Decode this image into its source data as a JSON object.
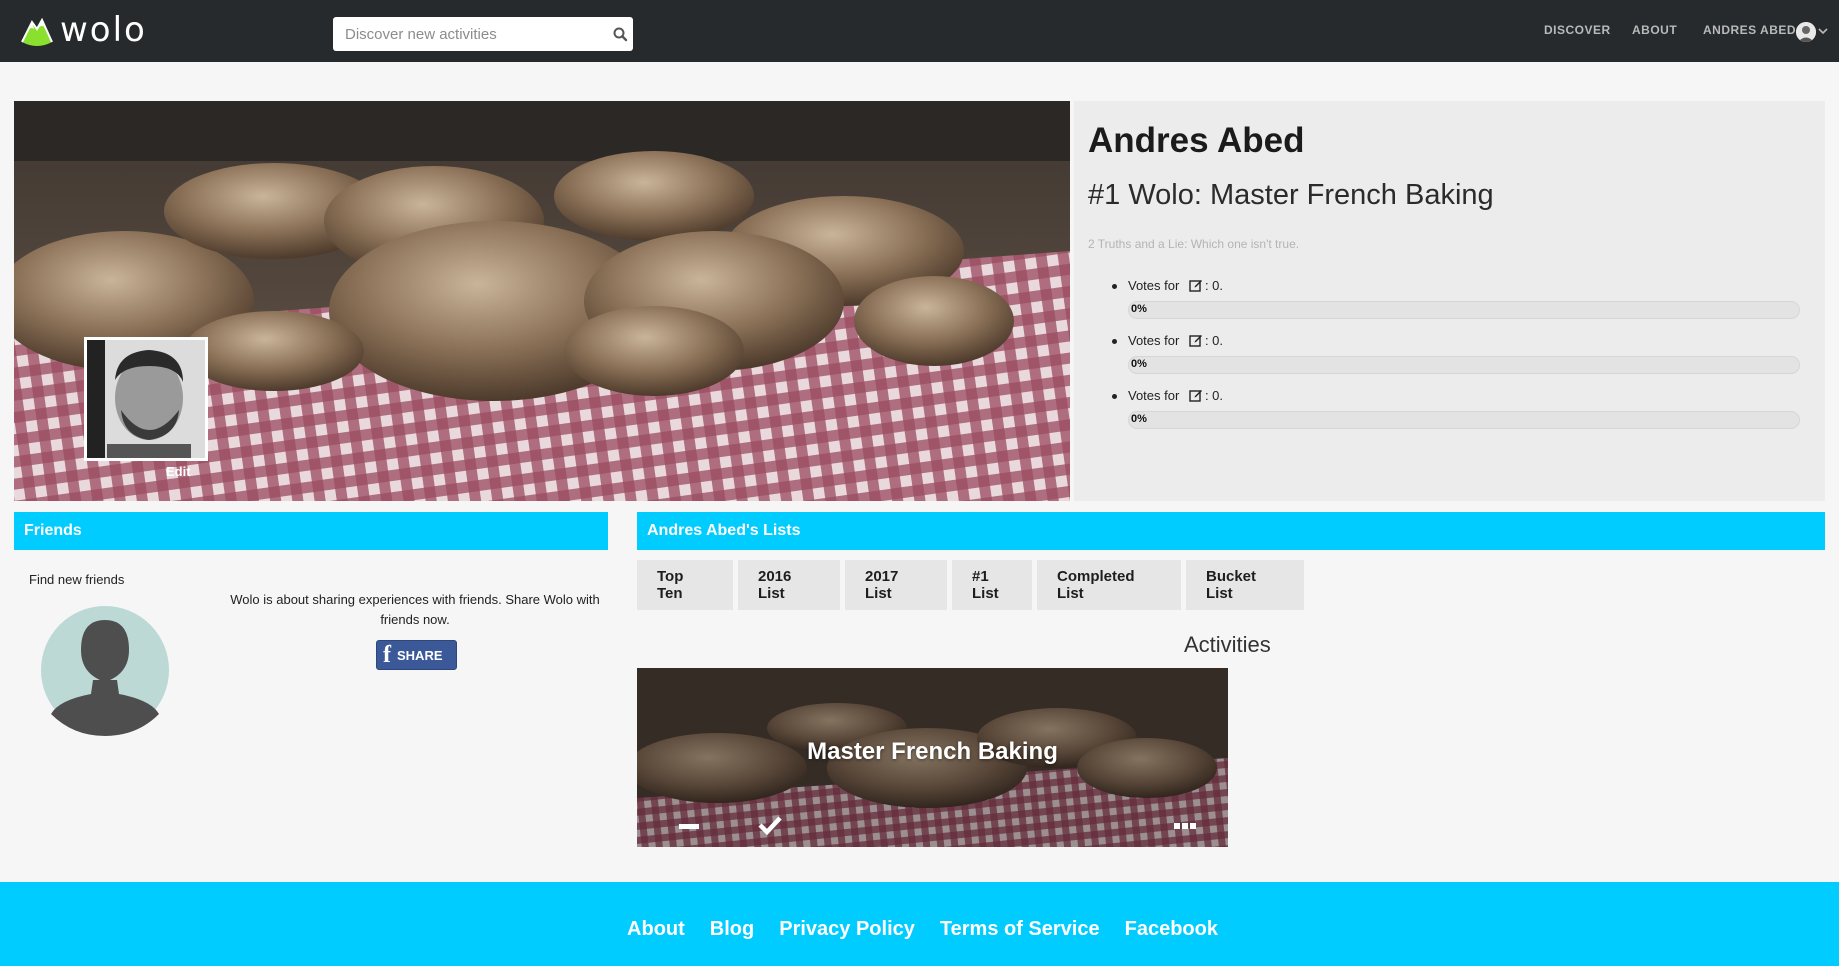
{
  "brand": {
    "name": "wolo",
    "accent": "#00ccff",
    "logo_green": "#8be02f"
  },
  "search": {
    "placeholder": "Discover new activities"
  },
  "nav": {
    "discover": "DISCOVER",
    "about": "ABOUT",
    "user": "ANDRES ABED"
  },
  "profile": {
    "name": "Andres Abed",
    "subtitle": "#1 Wolo: Master French Baking",
    "truths_prompt": "2 Truths and a Lie: Which one isn't true.",
    "edit_label": "Edit",
    "votes": [
      {
        "label": "Votes for",
        "count_text": ": 0.",
        "percent_text": "0%",
        "percent": 0
      },
      {
        "label": "Votes for",
        "count_text": ": 0.",
        "percent_text": "0%",
        "percent": 0
      },
      {
        "label": "Votes for",
        "count_text": ": 0.",
        "percent_text": "0%",
        "percent": 0
      }
    ]
  },
  "friends": {
    "heading": "Friends",
    "find_label": "Find new friends",
    "share_text": "Wolo is about sharing experiences with friends. Share Wolo with friends now.",
    "share_button": "SHARE",
    "share_icon": "facebook-icon"
  },
  "lists": {
    "heading": "Andres Abed's Lists",
    "tabs": [
      "Top Ten",
      "2016 List",
      "2017 List",
      "#1 List",
      "Completed List",
      "Bucket List"
    ],
    "activities_heading": "Activities",
    "activity": {
      "title": "Master French Baking",
      "icons": [
        "minus-icon",
        "check-icon",
        "more-icon"
      ]
    }
  },
  "footer": {
    "links": [
      "About",
      "Blog",
      "Privacy Policy",
      "Terms of Service",
      "Facebook"
    ]
  }
}
